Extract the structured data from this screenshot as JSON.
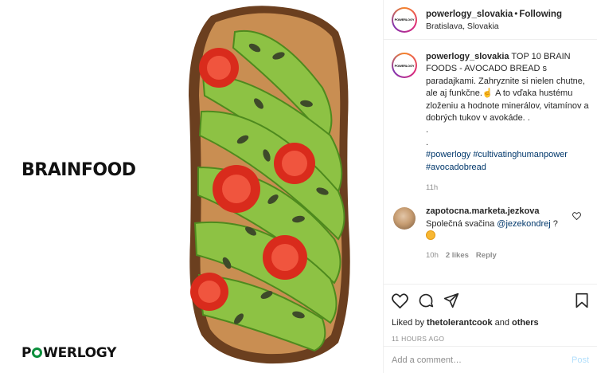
{
  "photo": {
    "headline": "BRAINFOOD",
    "brand_pre": "P",
    "brand_post": "WERLOGY"
  },
  "header": {
    "avatar_text": "POWERLOGY",
    "username": "powerlogy_slovakia",
    "separator": "•",
    "follow_state": "Following",
    "location": "Bratislava, Slovakia"
  },
  "caption": {
    "username": "powerlogy_slovakia",
    "text": "TOP 10 BRAIN FOODS - AVOCADO BREAD s paradajkami. Zahryznite si nielen chutne, ale aj funkčne.☝️ A to vďaka hustému zloženiu a hodnote minerálov, vitamínov a dobrých tukov v avokáde. .",
    "dot1": ".",
    "dot2": ".",
    "hashtags": "#powerlogy #cultivatinghumanpower #avocadobread",
    "time": "11h"
  },
  "comment": {
    "username": "zapotocna.marketa.jezkova",
    "text": "Společná svačina",
    "mention": "@jezekondrej",
    "text_end": "?",
    "time": "10h",
    "likes": "2 likes",
    "reply": "Reply"
  },
  "actions": {
    "liked_prefix": "Liked by",
    "liked_user": "thetolerantcook",
    "liked_and": "and",
    "liked_others": "others",
    "timestamp": "11 HOURS AGO"
  },
  "add_comment": {
    "placeholder": "Add a comment…",
    "post_label": "Post"
  },
  "colors": {
    "link": "#00376b",
    "muted": "#8e8e8e",
    "post_disabled": "#b2dffc",
    "brand_green": "#0a8f3c"
  }
}
